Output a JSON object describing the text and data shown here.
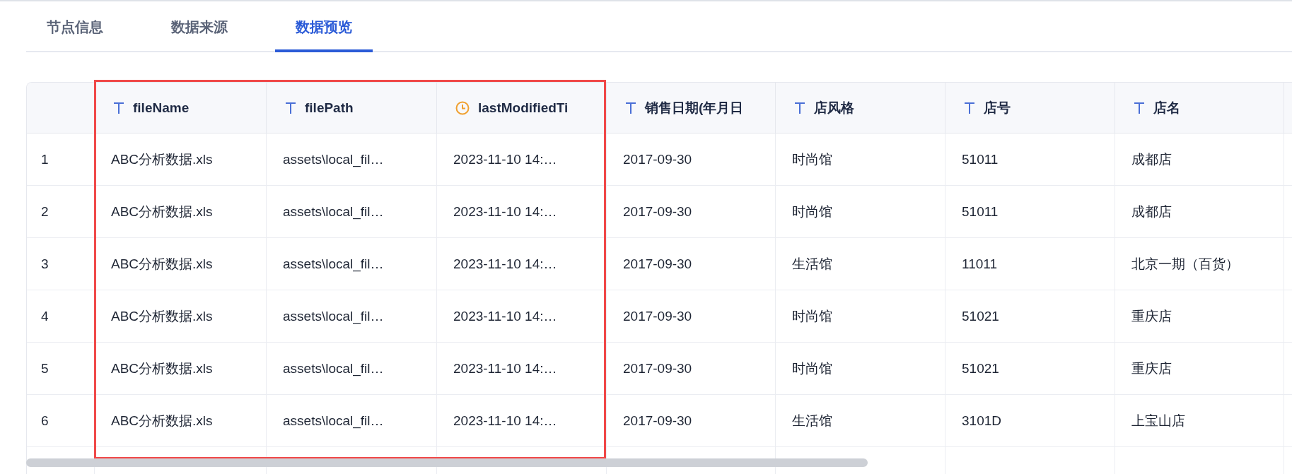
{
  "tabs": [
    {
      "label": "节点信息",
      "selected": false
    },
    {
      "label": "数据来源",
      "selected": false
    },
    {
      "label": "数据预览",
      "selected": true
    }
  ],
  "table": {
    "columns": [
      {
        "kind": "index"
      },
      {
        "label": "fileName",
        "kind": "text"
      },
      {
        "label": "filePath",
        "kind": "text"
      },
      {
        "label": "lastModifiedTi",
        "kind": "time"
      },
      {
        "label": "销售日期(年月日",
        "kind": "text"
      },
      {
        "label": "店风格",
        "kind": "text"
      },
      {
        "label": "店号",
        "kind": "text"
      },
      {
        "label": "店名",
        "kind": "text"
      }
    ],
    "rows": [
      [
        "1",
        "ABC分析数据.xls",
        "assets\\local_fil…",
        "2023-11-10 14:…",
        "2017-09-30",
        "时尚馆",
        "51011",
        "成都店"
      ],
      [
        "2",
        "ABC分析数据.xls",
        "assets\\local_fil…",
        "2023-11-10 14:…",
        "2017-09-30",
        "时尚馆",
        "51011",
        "成都店"
      ],
      [
        "3",
        "ABC分析数据.xls",
        "assets\\local_fil…",
        "2023-11-10 14:…",
        "2017-09-30",
        "生活馆",
        "11011",
        "北京一期（百货）"
      ],
      [
        "4",
        "ABC分析数据.xls",
        "assets\\local_fil…",
        "2023-11-10 14:…",
        "2017-09-30",
        "时尚馆",
        "51021",
        "重庆店"
      ],
      [
        "5",
        "ABC分析数据.xls",
        "assets\\local_fil…",
        "2023-11-10 14:…",
        "2017-09-30",
        "时尚馆",
        "51021",
        "重庆店"
      ],
      [
        "6",
        "ABC分析数据.xls",
        "assets\\local_fil…",
        "2023-11-10 14:…",
        "2017-09-30",
        "生活馆",
        "3101D",
        "上宝山店"
      ]
    ]
  }
}
